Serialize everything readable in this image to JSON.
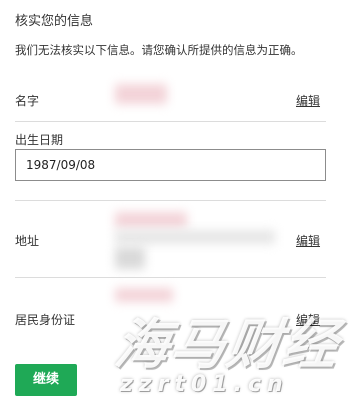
{
  "header": {
    "title": "核实您的信息",
    "notice": "我们无法核实以下信息。请您确认所提供的信息为正确。"
  },
  "fields": {
    "name": {
      "label": "名字",
      "edit_label": "编辑"
    },
    "dob": {
      "label": "出生日期",
      "value": "1987/09/08"
    },
    "address": {
      "label": "地址",
      "edit_label": "编辑"
    },
    "id": {
      "label": "居民身份证",
      "edit_label": "编辑"
    }
  },
  "actions": {
    "continue_label": "继续"
  },
  "watermark": {
    "main": "海马财经",
    "sub": "zzrt01.cn"
  },
  "colors": {
    "accent": "#1fa956",
    "divider": "#dcdcdc",
    "redaction": "#f3d3d8"
  }
}
